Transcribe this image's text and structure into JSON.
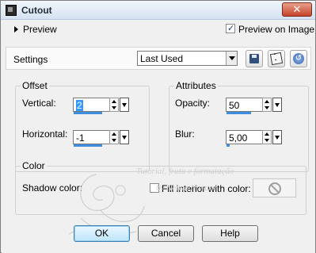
{
  "window": {
    "title": "Cutout",
    "close_symbol": "✕"
  },
  "preview": {
    "toggle_label": "Preview",
    "on_image_label": "Preview on Image",
    "on_image_checked": true
  },
  "settings": {
    "label": "Settings",
    "preset_value": "Last Used"
  },
  "offset": {
    "title": "Offset",
    "vertical_label": "Vertical:",
    "vertical_value": "2",
    "horizontal_label": "Horizontal:",
    "horizontal_value": "-1"
  },
  "attributes": {
    "title": "Attributes",
    "opacity_label": "Opacity:",
    "opacity_value": "50",
    "blur_label": "Blur:",
    "blur_value": "5,00"
  },
  "color": {
    "title": "Color",
    "shadow_label": "Shadow color:",
    "fill_label": "Fill interior with color:",
    "fill_checked": false
  },
  "buttons": {
    "ok": "OK",
    "cancel": "Cancel",
    "help": "Help"
  },
  "watermark": {
    "line1": "Tutorial, fruta e formatação",
    "line2": "by  Neusa Novaes"
  },
  "colors": {
    "accent": "#3d8de0",
    "close": "#c7442a",
    "default_button": "#bee6fd"
  }
}
